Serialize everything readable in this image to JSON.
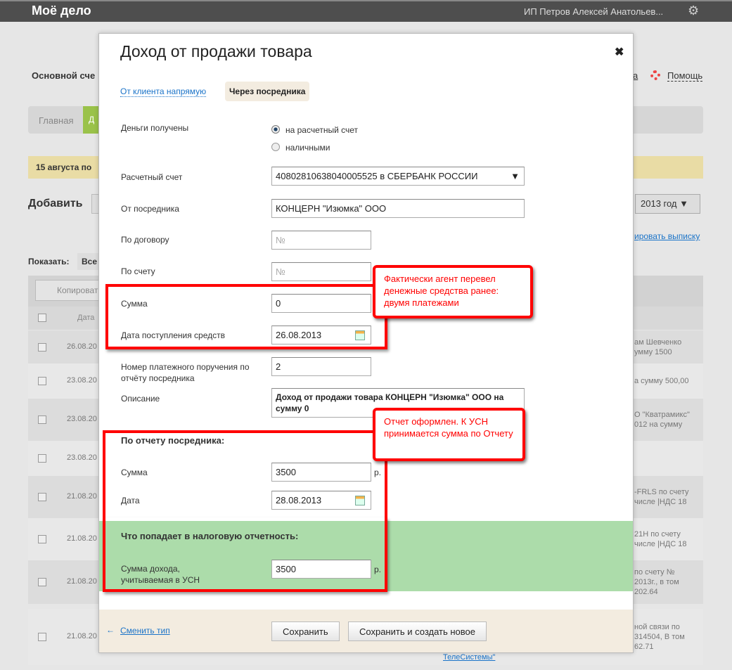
{
  "header": {
    "logo": "Моё дело",
    "user": "ИП Петров Алексей Анатольев...",
    "gear_icon": "gear-icon"
  },
  "background": {
    "account_title": "Основной сче",
    "help": "Помощь",
    "partial_link": "а",
    "nav_home": "Главная",
    "nav_active": "Д",
    "notice": "15 августа по",
    "add_label": "Добавить",
    "year_select": "2013 год",
    "export_link": "ировать выписку",
    "show_label": "Показать:",
    "show_value": "Все",
    "copy_button": "Копироват",
    "col_date": "Дата",
    "rows": [
      {
        "date": "26.08.20",
        "text": [
          "ам Шевченко",
          "умму 1500"
        ]
      },
      {
        "date": "23.08.20",
        "text": [
          "а сумму 500,00"
        ]
      },
      {
        "date": "23.08.20",
        "text": [
          "О \"Кватрамикс\"",
          "012 на сумму"
        ]
      },
      {
        "date": "23.08.20",
        "text": []
      },
      {
        "date": "21.08.20",
        "text": [
          "-FRLS по счету",
          "числе |НДС 18"
        ]
      },
      {
        "date": "21.08.20",
        "text": [
          "21Н по счету",
          "числе |НДС 18"
        ]
      },
      {
        "date": "21.08.20",
        "text": [
          "по счету №",
          "2013г., в том",
          "202.64"
        ]
      },
      {
        "date": "21.08.20",
        "text": [
          "ной связи по",
          "314504, В том",
          "62.71"
        ]
      }
    ],
    "bottom_link": "ТелеСистемы\""
  },
  "modal": {
    "title": "Доход от продажи товара",
    "tab_direct": "От клиента напрямую",
    "tab_agent": "Через посредника",
    "money_received_label": "Деньги получены",
    "radio_account": "на расчетный счет",
    "radio_cash": "наличными",
    "account_label": "Расчетный счет",
    "account_value": "40802810638040005525 в СБЕРБАНК РОССИИ",
    "agent_label": "От посредника",
    "agent_value": "КОНЦЕРН \"Изюмка\" ООО",
    "contract_label": "По договору",
    "contract_placeholder": "№",
    "invoice_label": "По счету",
    "invoice_placeholder": "№",
    "sum_label": "Сумма",
    "sum_value": "0",
    "date_label": "Дата поступления средств",
    "date_value": "26.08.2013",
    "order_label": "Номер платежного поручения по отчёту посредника",
    "order_value": "2",
    "desc_label": "Описание",
    "desc_value": "Доход от продажи товара КОНЦЕРН \"Изюмка\" ООО на сумму 0",
    "report_heading": "По отчету посредника:",
    "report_sum_label": "Сумма",
    "report_sum_value": "3500",
    "currency": "р.",
    "report_date_label": "Дата",
    "report_date_value": "28.08.2013",
    "tax_heading": "Что попадает в налоговую отчетность:",
    "tax_sum_label": "Сумма дохода, учитываемая в УСН",
    "tax_sum_value": "3500",
    "change_type": "Сменить тип",
    "save": "Сохранить",
    "save_new": "Сохранить и создать новое"
  },
  "callouts": {
    "first": "Фактически агент перевел денежные средства ранее: двумя платежами",
    "second": "Отчет оформлен. К УСН принимается сумма по Отчету"
  }
}
